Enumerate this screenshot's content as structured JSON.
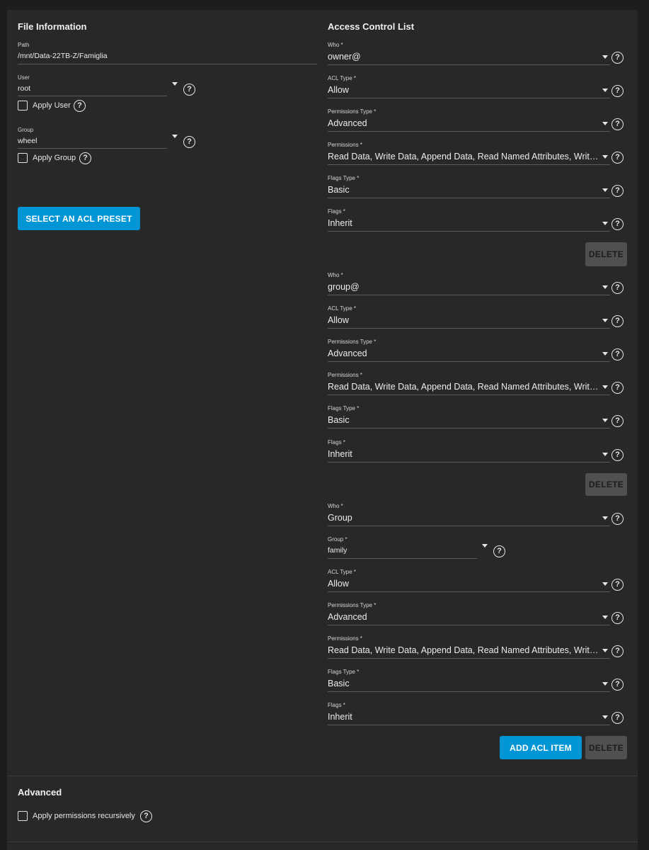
{
  "file_info": {
    "title": "File Information",
    "path_label": "Path",
    "path_value": "/mnt/Data-22TB-Z/Famiglia",
    "user_label": "User",
    "user_value": "root",
    "apply_user_label": "Apply User",
    "group_label": "Group",
    "group_value": "wheel",
    "apply_group_label": "Apply Group",
    "preset_button": "SELECT AN ACL PRESET"
  },
  "acl": {
    "title": "Access Control List",
    "help_glyph": "?",
    "entries": [
      {
        "who_label": "Who *",
        "who_value": "owner@",
        "acl_type_label": "ACL Type *",
        "acl_type_value": "Allow",
        "perm_type_label": "Permissions Type *",
        "perm_type_value": "Advanced",
        "perms_label": "Permissions *",
        "perms_value": "Read Data, Write Data, Append Data, Read Named Attributes, Writ…",
        "flags_type_label": "Flags Type *",
        "flags_type_value": "Basic",
        "flags_label": "Flags *",
        "flags_value": "Inherit",
        "delete_label": "DELETE"
      },
      {
        "who_label": "Who *",
        "who_value": "group@",
        "acl_type_label": "ACL Type *",
        "acl_type_value": "Allow",
        "perm_type_label": "Permissions Type *",
        "perm_type_value": "Advanced",
        "perms_label": "Permissions *",
        "perms_value": "Read Data, Write Data, Append Data, Read Named Attributes, Writ…",
        "flags_type_label": "Flags Type *",
        "flags_type_value": "Basic",
        "flags_label": "Flags *",
        "flags_value": "Inherit",
        "delete_label": "DELETE"
      },
      {
        "who_label": "Who *",
        "who_value": "Group",
        "group_label": "Group *",
        "group_value": "family",
        "acl_type_label": "ACL Type *",
        "acl_type_value": "Allow",
        "perm_type_label": "Permissions Type *",
        "perm_type_value": "Advanced",
        "perms_label": "Permissions *",
        "perms_value": "Read Data, Write Data, Append Data, Read Named Attributes, Writ…",
        "flags_type_label": "Flags Type *",
        "flags_type_value": "Basic",
        "flags_label": "Flags *",
        "flags_value": "Inherit",
        "delete_label": "DELETE"
      }
    ],
    "add_button": "ADD ACL ITEM"
  },
  "advanced": {
    "title": "Advanced",
    "recursive_label": "Apply permissions recursively"
  },
  "colors": {
    "page_bg": "#1d1d1d",
    "card_bg": "#282828",
    "accent": "#0095d5",
    "delete_bg": "#505050"
  },
  "icons": {
    "help": "help-circle-icon",
    "dropdown": "caret-down-icon",
    "checkbox": "checkbox-unchecked"
  }
}
